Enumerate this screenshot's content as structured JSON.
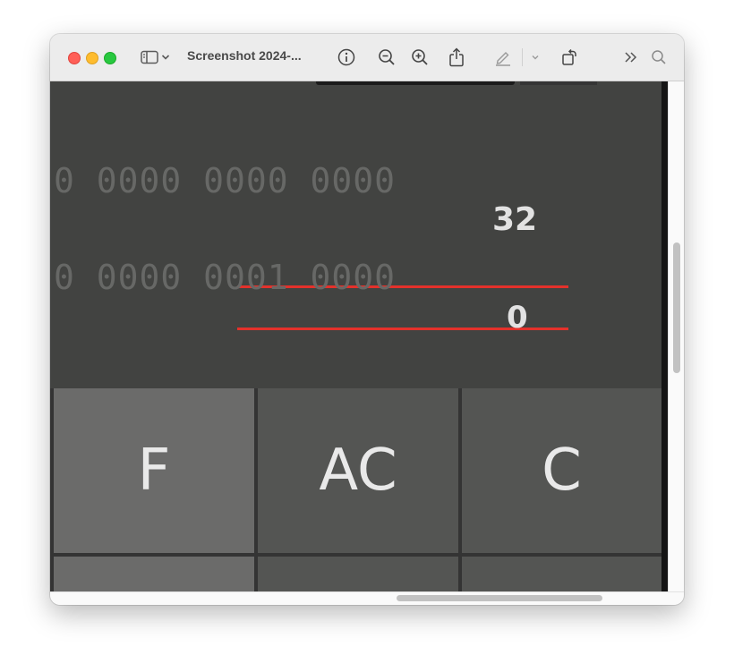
{
  "window": {
    "title": "Screenshot 2024-..."
  },
  "toolbar": {
    "icons": [
      "sidebar-icon",
      "chevron-down-icon",
      "info-icon",
      "zoom-out-icon",
      "zoom-in-icon",
      "share-icon",
      "markup-pen-icon",
      "chevron-down-icon",
      "rotate-icon",
      "more-chevrons-icon",
      "search-icon"
    ]
  },
  "display": {
    "row1_bits": "0 0000 0000 0000",
    "row1_value": "32",
    "row2_bits": "0 0000 0001 0000",
    "row2_value": "0",
    "highlight_color": "#e4312b"
  },
  "keys": {
    "k1": "F",
    "k2": "AC",
    "k3": "C"
  }
}
